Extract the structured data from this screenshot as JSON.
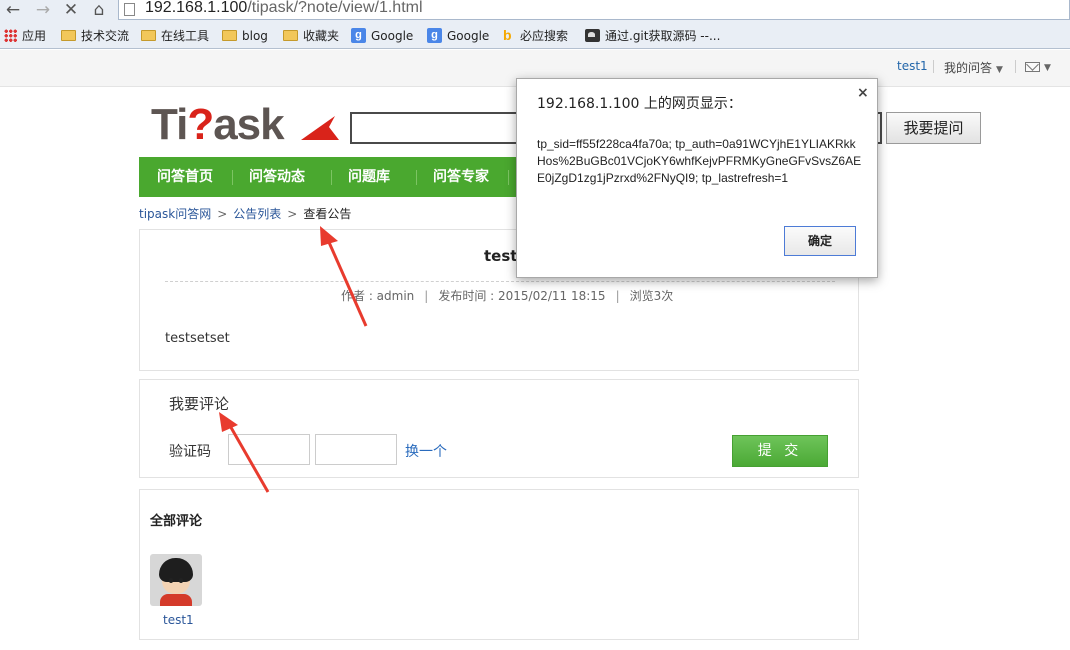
{
  "browser": {
    "url_host": "192.168.1.100",
    "url_path": "/tipask/?note/view/1.html",
    "bookmarks": [
      {
        "label": "应用",
        "icon": "apps-icon"
      },
      {
        "label": "技术交流",
        "icon": "folder-icon"
      },
      {
        "label": "在线工具",
        "icon": "folder-icon"
      },
      {
        "label": "blog",
        "icon": "folder-icon"
      },
      {
        "label": "收藏夹",
        "icon": "folder-icon"
      },
      {
        "label": "Google",
        "icon": "google-icon"
      },
      {
        "label": "Google",
        "icon": "google-icon"
      },
      {
        "label": "必应搜索",
        "icon": "bing-icon"
      },
      {
        "label": "通过.git获取源码 --...",
        "icon": "git-icon"
      }
    ]
  },
  "topbar": {
    "username": "test1",
    "my_questions": "我的问答",
    "mail_icon": "mail-icon"
  },
  "logo": {
    "part1": "Ti",
    "part2": "?",
    "part3": "ask"
  },
  "header": {
    "ask_button": "我要提问"
  },
  "nav": [
    "问答首页",
    "问答动态",
    "问题库",
    "问答专家"
  ],
  "breadcrumb": {
    "home": "tipask问答网",
    "list": "公告列表",
    "current": "查看公告"
  },
  "note": {
    "title": "test",
    "author": "作者 : admin",
    "published": "发布时间 : 2015/02/11 18:15",
    "views": "浏览3次",
    "body": "testsetset"
  },
  "comment_form": {
    "heading": "我要评论",
    "captcha_label": "验证码",
    "refresh_link": "换一个",
    "submit": "提 交"
  },
  "comments": {
    "heading": "全部评论",
    "items": [
      {
        "user": "test1"
      }
    ]
  },
  "dialog": {
    "title": "192.168.1.100 上的网页显示：",
    "close": "×",
    "message": "tp_sid=ff55f228ca4fa70a; tp_auth=0a91WCYjhE1YLIAKRkkHos%2BuGBc01VCjoKY6whfKejvPFRMKyGneGFvSvsZ6AEE0jZgD1zg1jPzrxd%2FNyQI9; tp_lastrefresh=1",
    "ok": "确定"
  },
  "colors": {
    "nav_green": "#4aa82f",
    "logo_red": "#d9231a",
    "arrow_red": "#e83b2e",
    "link_blue": "#2a5699"
  }
}
